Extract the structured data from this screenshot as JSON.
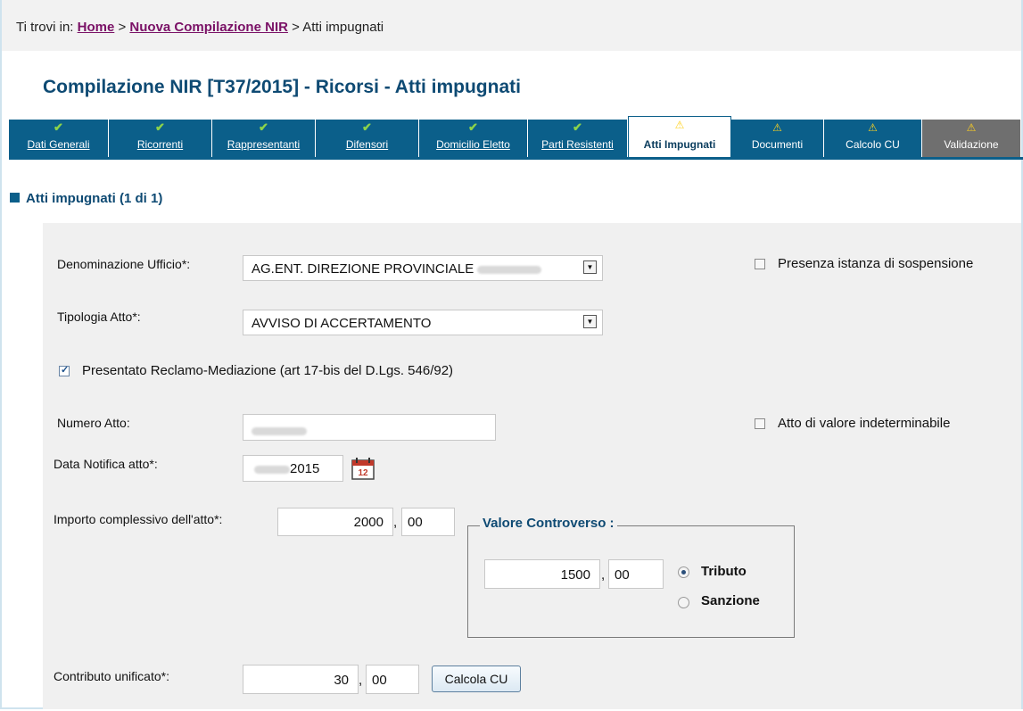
{
  "breadcrumb": {
    "prefix": "Ti trovi in:",
    "home": "Home",
    "sep1": ">",
    "nir": "Nuova Compilazione NIR",
    "sep2": ">",
    "current": "Atti impugnati"
  },
  "page": {
    "title": "Compilazione NIR [T37/2015] - Ricorsi - Atti impugnati"
  },
  "tabs": [
    {
      "label": "Dati Generali",
      "status": "check-icon"
    },
    {
      "label": "Ricorrenti",
      "status": "check-icon"
    },
    {
      "label": "Rappresentanti",
      "status": "check-icon"
    },
    {
      "label": "Difensori",
      "status": "check-icon"
    },
    {
      "label": "Domicilio Eletto",
      "status": "check-icon"
    },
    {
      "label": "Parti Resistenti",
      "status": "check-icon"
    },
    {
      "label": "Atti Impugnati",
      "status": "warning-icon",
      "active": true
    },
    {
      "label": "Documenti",
      "status": "warning-icon"
    },
    {
      "label": "Calcolo CU",
      "status": "warning-icon"
    },
    {
      "label": "Validazione",
      "status": "warning-icon"
    }
  ],
  "section": {
    "title": "Atti impugnati (1 di 1)"
  },
  "form": {
    "ufficio": {
      "label": "Denominazione Ufficio*:",
      "value": "AG.ENT. DIREZIONE PROVINCIALE"
    },
    "sospensione": {
      "label": "Presenza istanza di sospensione",
      "checked": false
    },
    "tipologia": {
      "label": "Tipologia Atto*:",
      "value": "AVVISO DI ACCERTAMENTO"
    },
    "reclamo": {
      "label": "Presentato Reclamo-Mediazione (art 17-bis del D.Lgs. 546/92)",
      "checked": true
    },
    "numero": {
      "label": "Numero Atto:"
    },
    "indeterminabile": {
      "label": "Atto di valore indeterminabile",
      "checked": false
    },
    "data_notifica": {
      "label": "Data Notifica atto*:",
      "value_year": "2015"
    },
    "importo": {
      "label": "Importo complessivo dell'atto*:",
      "int": "2000",
      "sep": ",",
      "dec": "00"
    },
    "valore_controverso": {
      "legend": "Valore Controverso :",
      "int": "1500",
      "sep": ",",
      "dec": "00",
      "options": [
        "Tributo",
        "Sanzione"
      ],
      "selected": "Tributo"
    },
    "contributo": {
      "label": "Contributo unificato*:",
      "int": "30",
      "sep": ",",
      "dec": "00",
      "button": "Calcola CU"
    }
  },
  "colors": {
    "tab_blue": "#0b5f8a",
    "title_blue": "#0e4a73",
    "breadcrumb_link": "#7a1166",
    "panel_grey": "#f0f0f0",
    "check_green": "#8cd34a",
    "warning_yellow": "#ffd21f"
  }
}
